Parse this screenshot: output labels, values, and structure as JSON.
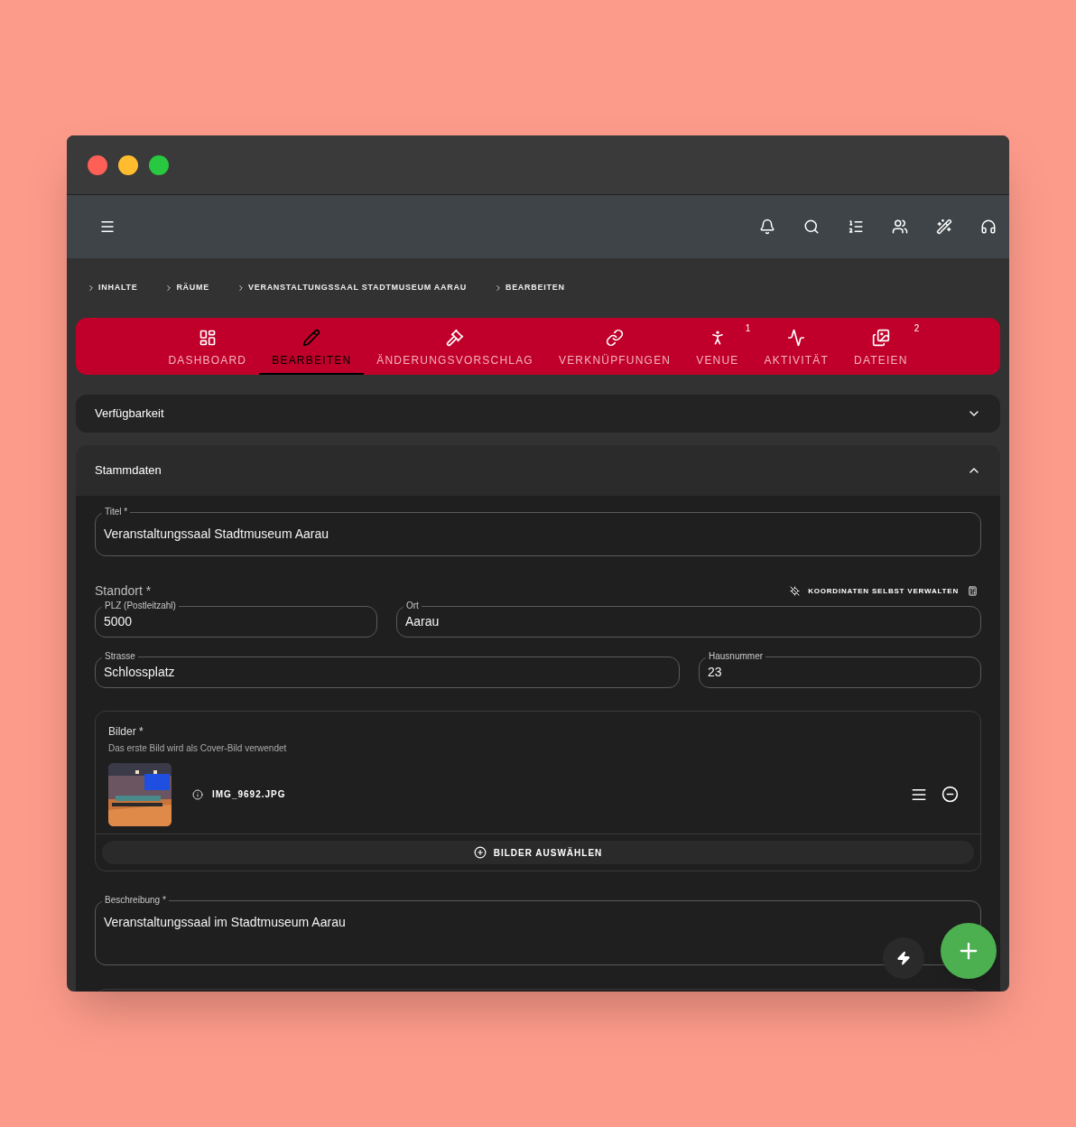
{
  "breadcrumbs": [
    "INHALTE",
    "RÄUME",
    "VERANSTALTUNGSSAAL STADTMUSEUM AARAU",
    "BEARBEITEN"
  ],
  "tabs": [
    {
      "label": "DASHBOARD",
      "selected": false
    },
    {
      "label": "BEARBEITEN",
      "selected": true
    },
    {
      "label": "ÄNDERUNGSVORSCHLAG",
      "selected": false
    },
    {
      "label": "VERKNÜPFUNGEN",
      "selected": false
    },
    {
      "label": "VENUE",
      "selected": false,
      "badge": "1"
    },
    {
      "label": "AKTIVITÄT",
      "selected": false
    },
    {
      "label": "DATEIEN",
      "selected": false,
      "badge": "2"
    }
  ],
  "sections": [
    {
      "title": "Verfügbarkeit",
      "expanded": false
    },
    {
      "title": "Stammdaten",
      "expanded": true
    }
  ],
  "form": {
    "title_field": {
      "label": "Titel *",
      "value": "Veranstaltungssaal Stadtmuseum Aarau"
    },
    "location": {
      "heading": "Standort *",
      "coords_button": "KOORDINATEN SELBST VERWALTEN",
      "fields": [
        {
          "label": "PLZ (Postleitzahl)",
          "value": "5000"
        },
        {
          "label": "Ort",
          "value": "Aarau"
        },
        {
          "label": "Strasse",
          "value": "Schlossplatz"
        },
        {
          "label": "Hausnummer",
          "value": "23"
        }
      ]
    },
    "images": {
      "heading": "Bilder *",
      "hint": "Das erste Bild wird als Cover-Bild verwendet",
      "files": [
        {
          "name": "IMG_9692.JPG"
        }
      ],
      "select_button": "BILDER AUSWÄHLEN"
    },
    "description": {
      "label": "Beschreibung *",
      "value": "Veranstaltungssaal im Stadtmuseum Aarau"
    }
  }
}
